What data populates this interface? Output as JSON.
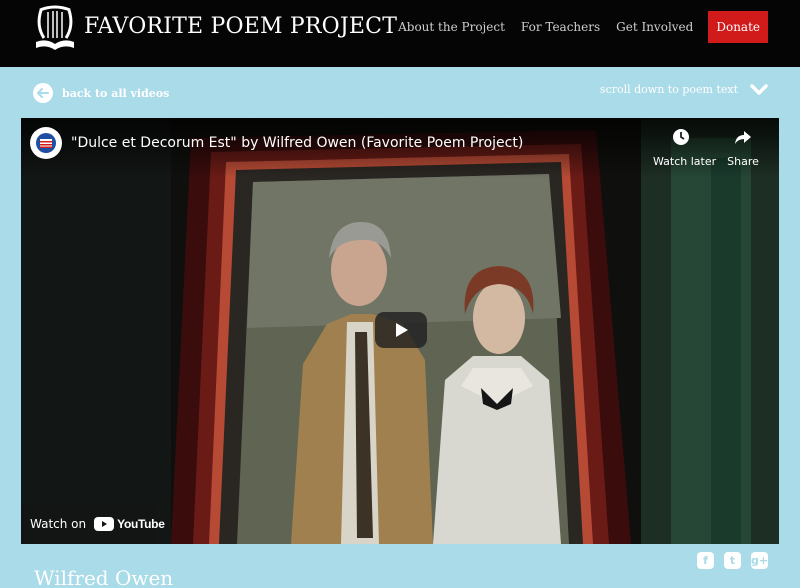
{
  "header": {
    "site_title": "FAVORITE POEM PROJECT",
    "logo_icon": "lyre-book-icon",
    "nav": {
      "about": "About the Project",
      "teachers": "For Teachers",
      "involved": "Get Involved",
      "donate": "Donate"
    },
    "donate_color": "#d11a1a"
  },
  "subnav": {
    "back_label": "back to all videos",
    "back_icon": "arrow-left-icon",
    "scroll_label": "scroll down to poem text",
    "scroll_icon": "chevron-down-icon"
  },
  "video": {
    "title": "\"Dulce et Decorum Est\" by Wilfred Owen (Favorite Poem Project)",
    "watch_later": "Watch later",
    "share": "Share",
    "watch_on": "Watch on",
    "youtube": "YouTube",
    "play_icon": "play-icon"
  },
  "social": {
    "facebook": "f",
    "twitter": "t",
    "googleplus": "g+"
  },
  "poet": {
    "name": "Wilfred Owen"
  },
  "colors": {
    "background": "#a9dbe8",
    "header": "#050505"
  }
}
